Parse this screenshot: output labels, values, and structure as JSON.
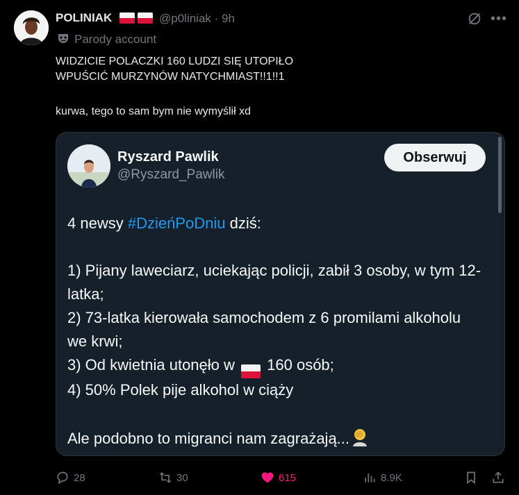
{
  "post": {
    "author_name": "POLINIAK",
    "author_flags": [
      "poland-flag",
      "poland-flag"
    ],
    "handle": "@p0liniak",
    "time": "· 9h",
    "label": "Parody account",
    "text_line1": "WIDZICIE POLACZKI 160 LUDZI SIĘ UTOPIŁO",
    "text_line2": "WPUŚCIĆ MURZYNÓW NATYCHMIAST!!1!!1",
    "text_line3": "kurwa, tego to sam bym nie wymyślił xd"
  },
  "quote": {
    "name": "Ryszard Pawlik",
    "handle": "@Ryszard_Pawlik",
    "follow_label": "Obserwuj",
    "intro_pre": "4 newsy ",
    "hashtag": "#DzieńPoDniu",
    "intro_post": " dziś:",
    "item1": "1) Pijany laweciarz, uciekając policji, zabił 3 osoby, w tym 12-latka;",
    "item2": "2) 73-latka kierowała samochodem z 6 promilami alkoholu we krwi;",
    "item3_pre": "3) Od kwietnia utonęło w ",
    "item3_post": " 160 osób;",
    "item4": "4) 50% Polek pije alkohol w ciąży",
    "closing": "Ale podobno to migranci nam zagrażają..."
  },
  "actions": {
    "replies": "28",
    "reposts": "30",
    "likes": "615",
    "views": "8.9K"
  },
  "colors": {
    "background": "#000000",
    "card": "#15202b",
    "hashtag": "#1d9bf0",
    "like": "#f91880",
    "muted": "#71767b"
  }
}
